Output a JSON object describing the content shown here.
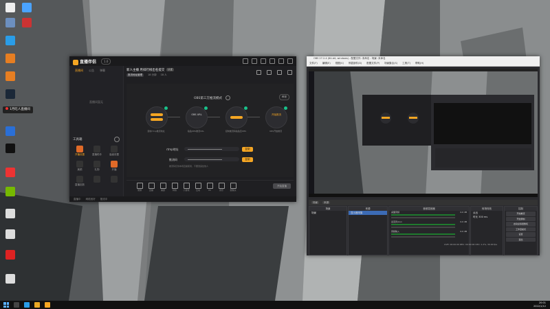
{
  "colors": {
    "accent": "#f5a623",
    "obs_selected": "#3c6bb5",
    "green_badge": "#19c28a"
  },
  "desktop": {
    "icons": [
      {
        "label": "",
        "icon": "user-folder-icon",
        "color": "#eee"
      },
      {
        "label": "",
        "icon": "network-icon",
        "color": "#4aa3ff"
      },
      {
        "label": "",
        "icon": "pc-icon",
        "color": "#6c8fbf"
      },
      {
        "label": "",
        "icon": "app-icon",
        "color": "#c33"
      },
      {
        "label": "",
        "icon": "edge-icon",
        "color": "#2a9de8"
      },
      {
        "label": "",
        "icon": "app-icon",
        "color": "#e67e22"
      },
      {
        "label": "",
        "icon": "app-icon",
        "color": "#e67e22"
      },
      {
        "label": "",
        "icon": "steam-icon",
        "color": "#1b2838"
      },
      {
        "label": "",
        "icon": "app-icon",
        "color": "#2a6fd6"
      },
      {
        "label": "",
        "icon": "penguin-icon",
        "color": "#111"
      },
      {
        "label": "",
        "icon": "app-icon",
        "color": "#e33"
      },
      {
        "label": "",
        "icon": "nvidia-icon",
        "color": "#76b900"
      },
      {
        "label": "",
        "icon": "document-icon",
        "color": "#ddd"
      },
      {
        "label": "",
        "icon": "document-icon",
        "color": "#ddd"
      },
      {
        "label": "",
        "icon": "music-icon",
        "color": "#d22"
      },
      {
        "label": "",
        "icon": "document-icon",
        "color": "#ddd"
      }
    ],
    "banner_text": "1月吃人直播间"
  },
  "live_app": {
    "logo_text": "直播伴侣",
    "version": "1.0",
    "sidebar_tabs": [
      "直播间",
      "公告",
      "弹幕"
    ],
    "sidebar_empty_text": "直播间暂无",
    "tools_title": "工具箱",
    "tools": [
      {
        "label": "开播设置",
        "selected": true
      },
      {
        "label": "直播助手",
        "selected": false
      },
      {
        "label": "高级设置",
        "selected": false
      },
      {
        "label": "美颜",
        "selected": false
      },
      {
        "label": "礼物",
        "selected": false
      },
      {
        "label": "开播",
        "selected": false
      },
      {
        "label": "直播回放",
        "selected": false
      },
      {
        "label": "",
        "selected": false
      },
      {
        "label": "",
        "selected": false
      }
    ],
    "room_title": "新人主播 月排行榜出名提交",
    "room_tag": "认证",
    "room_meta": {
      "btn": "推流地址管理",
      "a": "18 分钟",
      "b": "18 人"
    },
    "stage_title": "OBS第三方推流模式",
    "tutorial_label": "教程",
    "steps": [
      {
        "text": ""
      },
      {
        "text": "OBS URL"
      },
      {
        "text": "推流地址"
      },
      {
        "text": "开始推流"
      }
    ],
    "step_labels": [
      "复制rtmp推流地址",
      "粘贴OBS推流URL",
      "复制推流码粘贴至OBS",
      "OBS开始推流"
    ],
    "form": {
      "rtmp_label": "rtmp地址",
      "key_label": "推流码",
      "copy_label": "复制",
      "note": "推流码仅供本场直播使用，不要泄露给他人"
    },
    "bottom_tools": [
      "录屏",
      "直播",
      "美颜",
      "特效",
      "小游戏",
      "互动",
      "PK",
      "音乐",
      "摄像头"
    ],
    "start_label": "开始直播",
    "status_items": [
      "直播中",
      "网络良好",
      "推流中"
    ]
  },
  "obs": {
    "title": "OBS 27.2.4 (64-bit, windows) - 配置文件: 未命名 - 场景: 未命名",
    "menu": [
      "文件(F)",
      "编辑(E)",
      "视图(V)",
      "停靠部件(D)",
      "配置文件(P)",
      "场景集合(S)",
      "工具(T)",
      "帮助(H)"
    ],
    "dock_tabs": [
      "场景",
      "来源"
    ],
    "scenes_header": "场景",
    "scenes": [
      "场景"
    ],
    "sources_header": "来源",
    "sources": [
      "显示器采集"
    ],
    "mixer_header": "音频混音器",
    "mixer": [
      {
        "name": "桌面音频",
        "db": "0.0 dB"
      },
      {
        "name": "麦克风/Aux",
        "db": "0.0 dB"
      },
      {
        "name": "音频输入",
        "db": "0.0 dB"
      }
    ],
    "transitions_header": "转场特效",
    "transition_value": "淡出",
    "duration_label": "时长",
    "duration_value": "300 ms",
    "controls_header": "控制",
    "controls": [
      "开始推流",
      "开始录制",
      "启动虚拟摄像机",
      "工作室模式",
      "设置",
      "退出"
    ],
    "status": "LIVE: 00:00:00   REC: 00:00:00   CPU: 1.2%, 30.00 fps"
  },
  "taskbar": {
    "time": "20:01",
    "date": "2022/1/12"
  }
}
